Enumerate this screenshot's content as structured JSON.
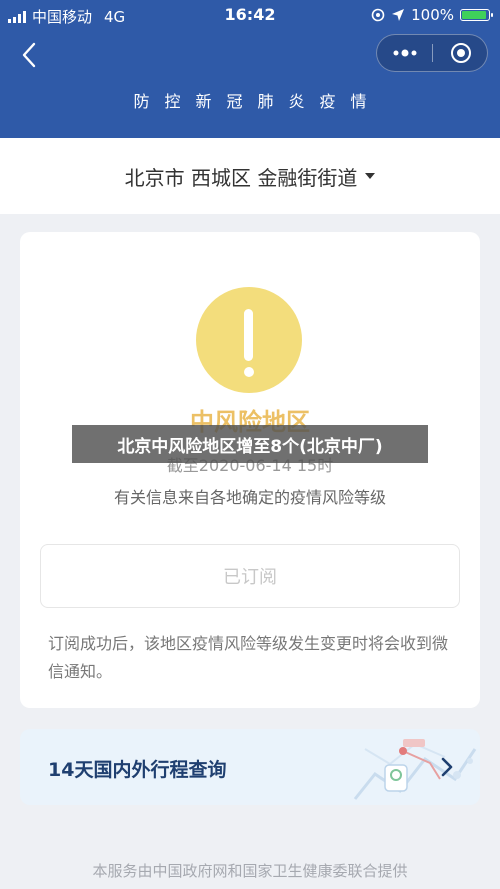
{
  "status": {
    "carrier": "中国移动",
    "network": "4G",
    "time": "16:42",
    "battery_percent": "100%",
    "battery_level": 1.0
  },
  "header": {
    "title": "防控新冠肺炎疫情",
    "more_icon": "more-dots-icon",
    "close_icon": "target-close-icon",
    "color": "#2f5aa8"
  },
  "location": {
    "label": "北京市 西城区 金融街街道"
  },
  "risk": {
    "level": "中风险地区",
    "as_of": "截至2020-06-14 15时",
    "source": "有关信息来自各地确定的疫情风险等级",
    "subscribe_button": "已订阅",
    "subscribe_note": "订阅成功后，该地区疫情风险等级发生变更时将会收到微信通知。",
    "color": "#f3dd7c"
  },
  "travel": {
    "label": "14天国内外行程查询"
  },
  "footer": {
    "text": "本服务由中国政府网和国家卫生健康委联合提供"
  },
  "overlay": {
    "caption": "北京中风险地区增至8个(北京中厂)"
  }
}
